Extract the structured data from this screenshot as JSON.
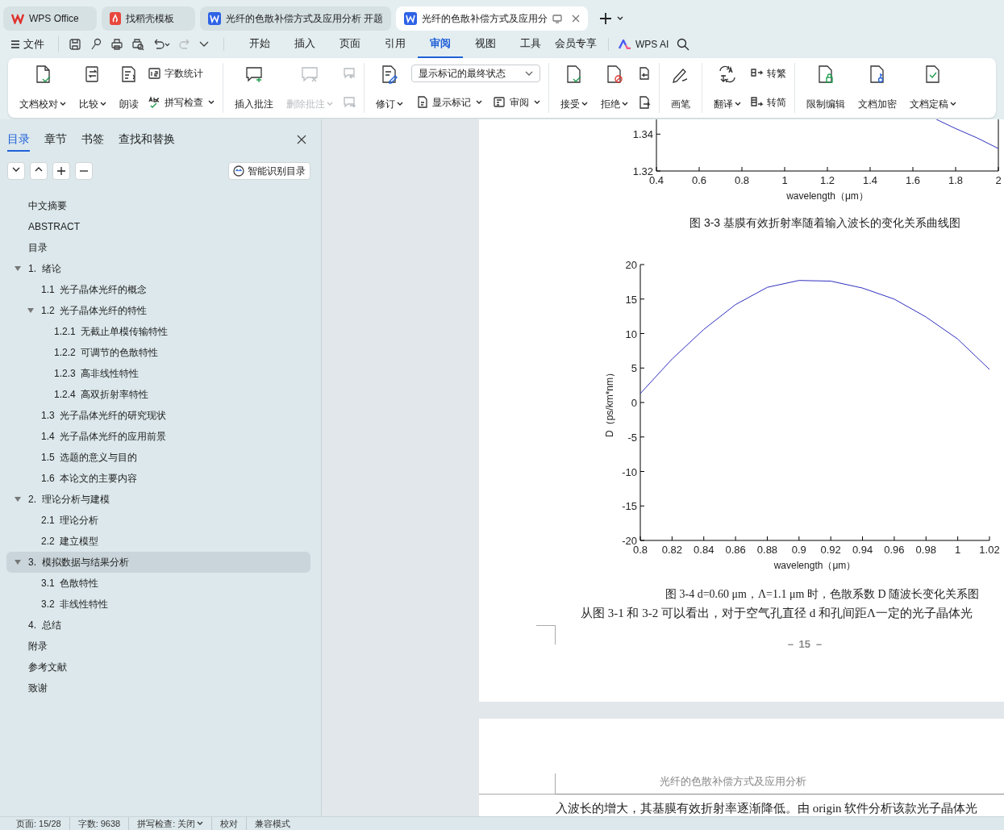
{
  "tabs": [
    {
      "label": "WPS Office",
      "kind": "home",
      "selected": false
    },
    {
      "label": "找稻壳模板",
      "kind": "template",
      "selected": false
    },
    {
      "label": "光纤的色散补偿方式及应用分析 开题",
      "kind": "doc",
      "selected": false
    },
    {
      "label": "光纤的色散补偿方式及应用分",
      "kind": "doc",
      "selected": true
    }
  ],
  "menu": {
    "file": "文件",
    "tabs": [
      {
        "label": "开始",
        "selected": false
      },
      {
        "label": "插入",
        "selected": false
      },
      {
        "label": "页面",
        "selected": false
      },
      {
        "label": "引用",
        "selected": false
      },
      {
        "label": "审阅",
        "selected": true
      },
      {
        "label": "视图",
        "selected": false
      },
      {
        "label": "工具",
        "selected": false
      },
      {
        "label": "会员专享",
        "selected": false
      }
    ],
    "ai": "WPS AI"
  },
  "ribbon": {
    "groups": [
      {
        "items": [
          {
            "kind": "large",
            "label": "文档校对",
            "dropdown": true,
            "disabled": false
          },
          {
            "kind": "large",
            "label": "比较",
            "dropdown": true,
            "disabled": false
          },
          {
            "kind": "large",
            "label": "朗读",
            "dropdown": false,
            "disabled": false
          },
          {
            "kind": "stack",
            "items": [
              {
                "label": "字数统计",
                "dropdown": false,
                "disabled": false
              },
              {
                "label": "拼写检查",
                "dropdown": true,
                "disabled": false
              }
            ]
          }
        ]
      },
      {
        "items": [
          {
            "kind": "large",
            "label": "插入批注",
            "dropdown": false,
            "disabled": false
          },
          {
            "kind": "large",
            "label": "删除批注",
            "dropdown": true,
            "disabled": true
          },
          {
            "kind": "stack",
            "items": [
              {
                "dropdown": false,
                "disabled": true
              },
              {
                "dropdown": false,
                "disabled": true
              }
            ]
          }
        ]
      },
      {
        "items": [
          {
            "kind": "large",
            "label": "修订",
            "dropdown": true,
            "disabled": false
          },
          {
            "kind": "select",
            "value": "显示标记的最终状态",
            "items": [
              {
                "label": "显示标记",
                "dropdown": true,
                "disabled": false
              },
              {
                "label": "审阅",
                "dropdown": true,
                "disabled": false
              }
            ]
          }
        ]
      },
      {
        "items": [
          {
            "kind": "large",
            "label": "接受",
            "dropdown": true,
            "disabled": false
          },
          {
            "kind": "large",
            "label": "拒绝",
            "dropdown": true,
            "disabled": false
          },
          {
            "kind": "stack",
            "items": [
              {
                "dropdown": false,
                "disabled": false
              },
              {
                "dropdown": false,
                "disabled": false
              }
            ]
          }
        ]
      },
      {
        "items": [
          {
            "kind": "large",
            "label": "画笔",
            "dropdown": false,
            "disabled": false
          }
        ]
      },
      {
        "items": [
          {
            "kind": "large",
            "label": "翻译",
            "dropdown": true,
            "disabled": false
          },
          {
            "kind": "stack",
            "items": [
              {
                "label": "转繁",
                "dropdown": false,
                "disabled": false
              },
              {
                "label": "转简",
                "dropdown": false,
                "disabled": false
              }
            ]
          }
        ]
      },
      {
        "items": [
          {
            "kind": "large",
            "label": "限制编辑",
            "dropdown": false,
            "disabled": false
          },
          {
            "kind": "large",
            "label": "文档加密",
            "dropdown": false,
            "disabled": false
          },
          {
            "kind": "large",
            "label": "文档定稿",
            "dropdown": true,
            "disabled": false
          }
        ]
      }
    ]
  },
  "sidebar": {
    "tabs": [
      {
        "label": "目录",
        "selected": true
      },
      {
        "label": "章节",
        "selected": false
      },
      {
        "label": "书签",
        "selected": false
      },
      {
        "label": "查找和替换",
        "selected": false
      }
    ],
    "smart_button": "智能识别目录",
    "toc": [
      {
        "label": "中文摘要",
        "selected": false
      },
      {
        "label": "ABSTRACT",
        "selected": false
      },
      {
        "label": "目录",
        "selected": false
      },
      {
        "label": "1.  绪论",
        "selected": false,
        "expanded": true,
        "children": [
          {
            "label": "1.1  光子晶体光纤的概念",
            "selected": false
          },
          {
            "label": "1.2  光子晶体光纤的特性",
            "selected": false,
            "expanded": true,
            "children": [
              {
                "label": "1.2.1  无截止单模传输特性",
                "selected": false
              },
              {
                "label": "1.2.2  可调节的色散特性",
                "selected": false
              },
              {
                "label": "1.2.3  高非线性特性",
                "selected": false
              },
              {
                "label": "1.2.4  高双折射率特性",
                "selected": false
              }
            ]
          },
          {
            "label": "1.3  光子晶体光纤的研究现状",
            "selected": false
          },
          {
            "label": "1.4  光子晶体光纤的应用前景",
            "selected": false
          },
          {
            "label": "1.5  选题的意义与目的",
            "selected": false
          },
          {
            "label": "1.6  本论文的主要内容",
            "selected": false
          }
        ]
      },
      {
        "label": "2.  理论分析与建模",
        "selected": false,
        "expanded": true,
        "children": [
          {
            "label": "2.1  理论分析",
            "selected": false
          },
          {
            "label": "2.2  建立模型",
            "selected": false
          }
        ]
      },
      {
        "label": "3.  模拟数据与结果分析",
        "selected": true,
        "expanded": true,
        "children": [
          {
            "label": "3.1  色散特性",
            "selected": false
          },
          {
            "label": "3.2  非线性特性",
            "selected": false
          }
        ]
      },
      {
        "label": "4.  总结",
        "selected": false
      },
      {
        "label": "附录",
        "selected": false
      },
      {
        "label": "参考文献",
        "selected": false
      },
      {
        "label": "致谢",
        "selected": false
      }
    ]
  },
  "document": {
    "page1": {
      "figure1": {
        "chart_data": {
          "type": "line",
          "xlabel": "wavelength（μm）",
          "x": [
            1.71,
            1.8,
            1.9,
            2
          ],
          "series": [
            {
              "color": "#3030c0",
              "values": [
                1.348,
                1.343,
                1.338,
                1.3322
              ]
            }
          ],
          "xlim": [
            0.4,
            2
          ],
          "ylim": [
            1.32,
            1.348
          ],
          "xticks": [
            0.4,
            0.6,
            0.8,
            1,
            1.2,
            1.4,
            1.6,
            1.8,
            2
          ],
          "yticks": [
            1.32,
            1.34
          ]
        },
        "caption": "图 3-3  基膜有效折射率随着输入波长的变化关系曲线图"
      },
      "figure2": {
        "chart_data": {
          "type": "line",
          "xlabel": "wavelength（μm）",
          "ylabel": "D（ps/km*nm）",
          "x": [
            0.8,
            0.82,
            0.84,
            0.86,
            0.88,
            0.9,
            0.92,
            0.94,
            0.96,
            0.98,
            1,
            1.02
          ],
          "series": [
            {
              "color": "#3030c0",
              "values": [
                1.3,
                6.3,
                10.6,
                14.2,
                16.7,
                17.7,
                17.6,
                16.6,
                15.0,
                12.4,
                9.2,
                4.8
              ]
            }
          ],
          "xlim": [
            0.8,
            1.02
          ],
          "ylim": [
            -20,
            20
          ],
          "xticks": [
            0.8,
            0.82,
            0.84,
            0.86,
            0.88,
            0.9,
            0.92,
            0.94,
            0.96,
            0.98,
            1,
            1.02
          ],
          "yticks": [
            -20,
            -15,
            -10,
            -5,
            0,
            5,
            10,
            15,
            20
          ]
        },
        "caption": "图 3-4  d=0.60 μm，Λ=1.1 μm 时，色散系数 D 随波长变化关系图"
      },
      "paragraph": "从图 3-1 和 3-2 可以看出，对于空气孔直径 d 和孔间距Λ一定的光子晶体光",
      "page_number": "－ 15 －"
    },
    "page2": {
      "header": "光纤的色散补偿方式及应用分析",
      "paragraph": "入波长的增大，其基膜有效折射率逐渐降低。由 origin 软件分析该款光子晶体光"
    }
  },
  "status_bar": [
    {
      "label": "页面: 15/28",
      "dropdown": false
    },
    {
      "label": "字数: 9638",
      "dropdown": false
    },
    {
      "label": "拼写检查: 关闭",
      "dropdown": true
    },
    {
      "label": "校对",
      "dropdown": false
    },
    {
      "label": "兼容模式",
      "dropdown": false
    }
  ]
}
